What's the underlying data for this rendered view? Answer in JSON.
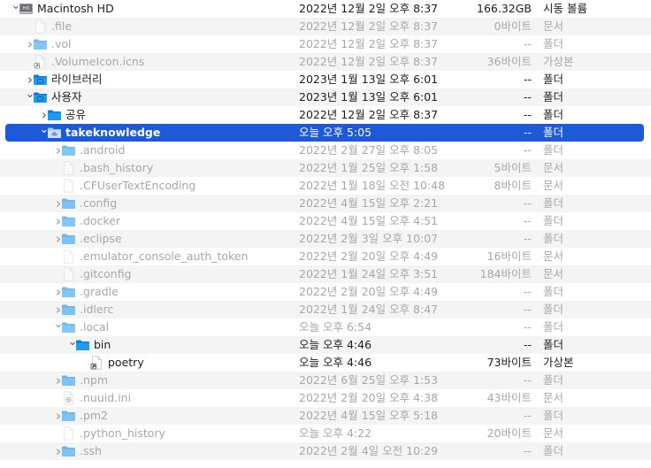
{
  "rows": [
    {
      "name": "Macintosh HD",
      "date": "2022년 12월 2일 오후 8:37",
      "size": "166.32GB",
      "kind": "시동 볼륨",
      "level": 0,
      "icon": "drive",
      "chevron": "down",
      "dim": false,
      "selected": false
    },
    {
      "name": ".file",
      "date": "2022년 12월 2일 오후 8:37",
      "size": "0바이트",
      "kind": "문서",
      "level": 1,
      "icon": "doc",
      "chevron": "none",
      "dim": true,
      "selected": false
    },
    {
      "name": ".vol",
      "date": "2022년 12월 2일 오후 8:37",
      "size": "--",
      "kind": "폴더",
      "level": 1,
      "icon": "folder",
      "chevron": "right",
      "dim": true,
      "selected": false
    },
    {
      "name": ".VolumeIcon.icns",
      "date": "2022년 12월 2일 오후 8:37",
      "size": "36바이트",
      "kind": "가상본",
      "level": 1,
      "icon": "alias",
      "chevron": "none",
      "dim": true,
      "selected": false
    },
    {
      "name": "라이브러리",
      "date": "2023년 1월 13일 오후 6:01",
      "size": "--",
      "kind": "폴더",
      "level": 1,
      "icon": "folder-special",
      "chevron": "right",
      "dim": false,
      "selected": false
    },
    {
      "name": "사용자",
      "date": "2023년 1월 13일 오후 6:01",
      "size": "--",
      "kind": "폴더",
      "level": 1,
      "icon": "folder-special",
      "chevron": "down",
      "dim": false,
      "selected": false
    },
    {
      "name": "공유",
      "date": "2022년 12월 2일 오후 8:37",
      "size": "--",
      "kind": "폴더",
      "level": 2,
      "icon": "folder",
      "chevron": "right",
      "dim": false,
      "selected": false
    },
    {
      "name": "takeknowledge",
      "date": "오늘 오후 5:05",
      "size": "--",
      "kind": "폴더",
      "level": 2,
      "icon": "folder-home",
      "chevron": "down",
      "dim": false,
      "selected": true
    },
    {
      "name": ".android",
      "date": "2022년 2월 27일 오후 8:05",
      "size": "--",
      "kind": "폴더",
      "level": 3,
      "icon": "folder",
      "chevron": "right",
      "dim": true,
      "selected": false
    },
    {
      "name": ".bash_history",
      "date": "2022년 1월 25일 오후 1:58",
      "size": "5바이트",
      "kind": "문서",
      "level": 3,
      "icon": "doc",
      "chevron": "none",
      "dim": true,
      "selected": false
    },
    {
      "name": ".CFUserTextEncoding",
      "date": "2022년 1월 18일 오전 10:48",
      "size": "8바이트",
      "kind": "문서",
      "level": 3,
      "icon": "doc",
      "chevron": "none",
      "dim": true,
      "selected": false
    },
    {
      "name": ".config",
      "date": "2022년 4월 15일 오후 2:21",
      "size": "--",
      "kind": "폴더",
      "level": 3,
      "icon": "folder",
      "chevron": "right",
      "dim": true,
      "selected": false
    },
    {
      "name": ".docker",
      "date": "2022년 4월 15일 오후 4:51",
      "size": "--",
      "kind": "폴더",
      "level": 3,
      "icon": "folder",
      "chevron": "right",
      "dim": true,
      "selected": false
    },
    {
      "name": ".eclipse",
      "date": "2022년 2월 3일 오후 10:07",
      "size": "--",
      "kind": "폴더",
      "level": 3,
      "icon": "folder",
      "chevron": "right",
      "dim": true,
      "selected": false
    },
    {
      "name": ".emulator_console_auth_token",
      "date": "2022년 2월 20일 오후 4:49",
      "size": "16바이트",
      "kind": "문서",
      "level": 3,
      "icon": "doc",
      "chevron": "none",
      "dim": true,
      "selected": false
    },
    {
      "name": ".gitconfig",
      "date": "2022년 1월 24일 오후 3:51",
      "size": "184바이트",
      "kind": "문서",
      "level": 3,
      "icon": "doc",
      "chevron": "none",
      "dim": true,
      "selected": false
    },
    {
      "name": ".gradle",
      "date": "2022년 2월 20일 오후 4:49",
      "size": "--",
      "kind": "폴더",
      "level": 3,
      "icon": "folder",
      "chevron": "right",
      "dim": true,
      "selected": false
    },
    {
      "name": ".idlerc",
      "date": "2022년 1월 24일 오후 8:47",
      "size": "--",
      "kind": "폴더",
      "level": 3,
      "icon": "folder",
      "chevron": "right",
      "dim": true,
      "selected": false
    },
    {
      "name": ".local",
      "date": "오늘 오후 6:54",
      "size": "--",
      "kind": "폴더",
      "level": 3,
      "icon": "folder",
      "chevron": "down",
      "dim": true,
      "selected": false
    },
    {
      "name": "bin",
      "date": "오늘 오후 4:46",
      "size": "--",
      "kind": "폴더",
      "level": 4,
      "icon": "folder",
      "chevron": "down",
      "dim": false,
      "selected": false
    },
    {
      "name": "poetry",
      "date": "오늘 오후 4:46",
      "size": "73바이트",
      "kind": "가상본",
      "level": 5,
      "icon": "alias",
      "chevron": "none",
      "dim": false,
      "selected": false
    },
    {
      "name": ".npm",
      "date": "2022년 6월 25일 오후 1:53",
      "size": "--",
      "kind": "폴더",
      "level": 3,
      "icon": "folder",
      "chevron": "right",
      "dim": true,
      "selected": false
    },
    {
      "name": ".nuuid.ini",
      "date": "2022년 2월 20일 오후 4:38",
      "size": "43바이트",
      "kind": "문서",
      "level": 3,
      "icon": "gear-doc",
      "chevron": "none",
      "dim": true,
      "selected": false
    },
    {
      "name": ".pm2",
      "date": "2022년 4월 15일 오후 5:18",
      "size": "--",
      "kind": "폴더",
      "level": 3,
      "icon": "folder",
      "chevron": "right",
      "dim": true,
      "selected": false
    },
    {
      "name": ".python_history",
      "date": "오늘 오후 4:22",
      "size": "20바이트",
      "kind": "문서",
      "level": 3,
      "icon": "doc",
      "chevron": "none",
      "dim": true,
      "selected": false
    },
    {
      "name": ".ssh",
      "date": "2022년 2월 4일 오전 10:29",
      "size": "--",
      "kind": "폴더",
      "level": 3,
      "icon": "folder",
      "chevron": "right",
      "dim": true,
      "selected": false
    }
  ],
  "colors": {
    "selection": "#1e5ad8",
    "folder": "#1f9bf0",
    "folder_dark": "#0d7fd6",
    "dim_text": "#a7a7ab",
    "stripe": "#f4f4f5"
  }
}
